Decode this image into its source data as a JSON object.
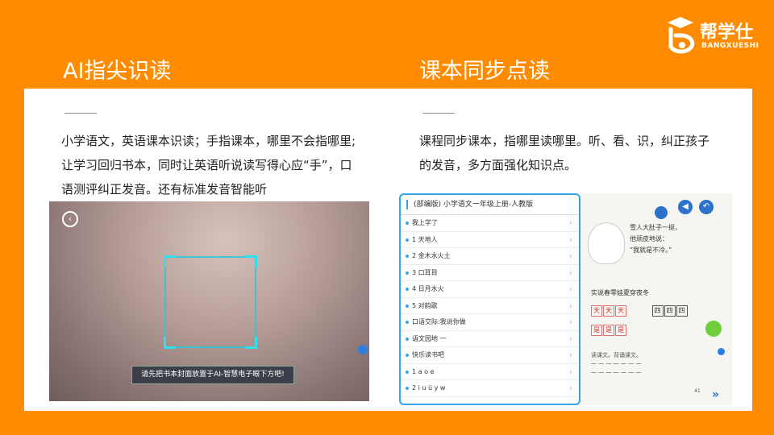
{
  "left": {
    "title": "AI指尖识读",
    "paragraph": "小学语文，英语课本识读；手指课本，哪里不会指哪里;让学习回归书本，同时让英语听说读写得心应“手”，口语测评纠正发音。还有标准发音智能听",
    "camera_tip": "请先把书本封面放置于AI-智慧电子眼下方吧!"
  },
  "right": {
    "title": "课本同步点读",
    "paragraph": "课程同步课本，指哪里读哪里。听、看、识，纠正孩子的发音，多方面强化知识点。",
    "list_title": "(部编版) 小学语文一年级上册-人教版",
    "lessons": [
      "我上学了",
      "1 天地人",
      "2 金木水火土",
      "3 口耳目",
      "4 日月水火",
      "5 对韵歌",
      "口语交际:我说你做",
      "语文园地 一",
      "快乐读书吧",
      "1 a o e",
      "2 i u ü y w"
    ],
    "page_number": "41"
  },
  "logo": {
    "name": "帮学仕",
    "sub": "BANGXUESHI"
  },
  "colors": {
    "background": "#FF8C00",
    "accent": "#37a6e8"
  }
}
